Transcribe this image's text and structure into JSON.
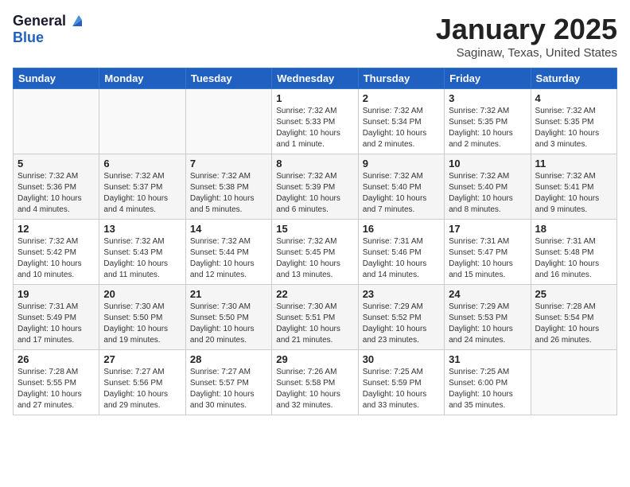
{
  "header": {
    "logo_general": "General",
    "logo_blue": "Blue",
    "month_title": "January 2025",
    "location": "Saginaw, Texas, United States"
  },
  "calendar": {
    "days_of_week": [
      "Sunday",
      "Monday",
      "Tuesday",
      "Wednesday",
      "Thursday",
      "Friday",
      "Saturday"
    ],
    "weeks": [
      [
        {
          "day": "",
          "content": ""
        },
        {
          "day": "",
          "content": ""
        },
        {
          "day": "",
          "content": ""
        },
        {
          "day": "1",
          "content": "Sunrise: 7:32 AM\nSunset: 5:33 PM\nDaylight: 10 hours\nand 1 minute."
        },
        {
          "day": "2",
          "content": "Sunrise: 7:32 AM\nSunset: 5:34 PM\nDaylight: 10 hours\nand 2 minutes."
        },
        {
          "day": "3",
          "content": "Sunrise: 7:32 AM\nSunset: 5:35 PM\nDaylight: 10 hours\nand 2 minutes."
        },
        {
          "day": "4",
          "content": "Sunrise: 7:32 AM\nSunset: 5:35 PM\nDaylight: 10 hours\nand 3 minutes."
        }
      ],
      [
        {
          "day": "5",
          "content": "Sunrise: 7:32 AM\nSunset: 5:36 PM\nDaylight: 10 hours\nand 4 minutes."
        },
        {
          "day": "6",
          "content": "Sunrise: 7:32 AM\nSunset: 5:37 PM\nDaylight: 10 hours\nand 4 minutes."
        },
        {
          "day": "7",
          "content": "Sunrise: 7:32 AM\nSunset: 5:38 PM\nDaylight: 10 hours\nand 5 minutes."
        },
        {
          "day": "8",
          "content": "Sunrise: 7:32 AM\nSunset: 5:39 PM\nDaylight: 10 hours\nand 6 minutes."
        },
        {
          "day": "9",
          "content": "Sunrise: 7:32 AM\nSunset: 5:40 PM\nDaylight: 10 hours\nand 7 minutes."
        },
        {
          "day": "10",
          "content": "Sunrise: 7:32 AM\nSunset: 5:40 PM\nDaylight: 10 hours\nand 8 minutes."
        },
        {
          "day": "11",
          "content": "Sunrise: 7:32 AM\nSunset: 5:41 PM\nDaylight: 10 hours\nand 9 minutes."
        }
      ],
      [
        {
          "day": "12",
          "content": "Sunrise: 7:32 AM\nSunset: 5:42 PM\nDaylight: 10 hours\nand 10 minutes."
        },
        {
          "day": "13",
          "content": "Sunrise: 7:32 AM\nSunset: 5:43 PM\nDaylight: 10 hours\nand 11 minutes."
        },
        {
          "day": "14",
          "content": "Sunrise: 7:32 AM\nSunset: 5:44 PM\nDaylight: 10 hours\nand 12 minutes."
        },
        {
          "day": "15",
          "content": "Sunrise: 7:32 AM\nSunset: 5:45 PM\nDaylight: 10 hours\nand 13 minutes."
        },
        {
          "day": "16",
          "content": "Sunrise: 7:31 AM\nSunset: 5:46 PM\nDaylight: 10 hours\nand 14 minutes."
        },
        {
          "day": "17",
          "content": "Sunrise: 7:31 AM\nSunset: 5:47 PM\nDaylight: 10 hours\nand 15 minutes."
        },
        {
          "day": "18",
          "content": "Sunrise: 7:31 AM\nSunset: 5:48 PM\nDaylight: 10 hours\nand 16 minutes."
        }
      ],
      [
        {
          "day": "19",
          "content": "Sunrise: 7:31 AM\nSunset: 5:49 PM\nDaylight: 10 hours\nand 17 minutes."
        },
        {
          "day": "20",
          "content": "Sunrise: 7:30 AM\nSunset: 5:50 PM\nDaylight: 10 hours\nand 19 minutes."
        },
        {
          "day": "21",
          "content": "Sunrise: 7:30 AM\nSunset: 5:50 PM\nDaylight: 10 hours\nand 20 minutes."
        },
        {
          "day": "22",
          "content": "Sunrise: 7:30 AM\nSunset: 5:51 PM\nDaylight: 10 hours\nand 21 minutes."
        },
        {
          "day": "23",
          "content": "Sunrise: 7:29 AM\nSunset: 5:52 PM\nDaylight: 10 hours\nand 23 minutes."
        },
        {
          "day": "24",
          "content": "Sunrise: 7:29 AM\nSunset: 5:53 PM\nDaylight: 10 hours\nand 24 minutes."
        },
        {
          "day": "25",
          "content": "Sunrise: 7:28 AM\nSunset: 5:54 PM\nDaylight: 10 hours\nand 26 minutes."
        }
      ],
      [
        {
          "day": "26",
          "content": "Sunrise: 7:28 AM\nSunset: 5:55 PM\nDaylight: 10 hours\nand 27 minutes."
        },
        {
          "day": "27",
          "content": "Sunrise: 7:27 AM\nSunset: 5:56 PM\nDaylight: 10 hours\nand 29 minutes."
        },
        {
          "day": "28",
          "content": "Sunrise: 7:27 AM\nSunset: 5:57 PM\nDaylight: 10 hours\nand 30 minutes."
        },
        {
          "day": "29",
          "content": "Sunrise: 7:26 AM\nSunset: 5:58 PM\nDaylight: 10 hours\nand 32 minutes."
        },
        {
          "day": "30",
          "content": "Sunrise: 7:25 AM\nSunset: 5:59 PM\nDaylight: 10 hours\nand 33 minutes."
        },
        {
          "day": "31",
          "content": "Sunrise: 7:25 AM\nSunset: 6:00 PM\nDaylight: 10 hours\nand 35 minutes."
        },
        {
          "day": "",
          "content": ""
        }
      ]
    ]
  }
}
